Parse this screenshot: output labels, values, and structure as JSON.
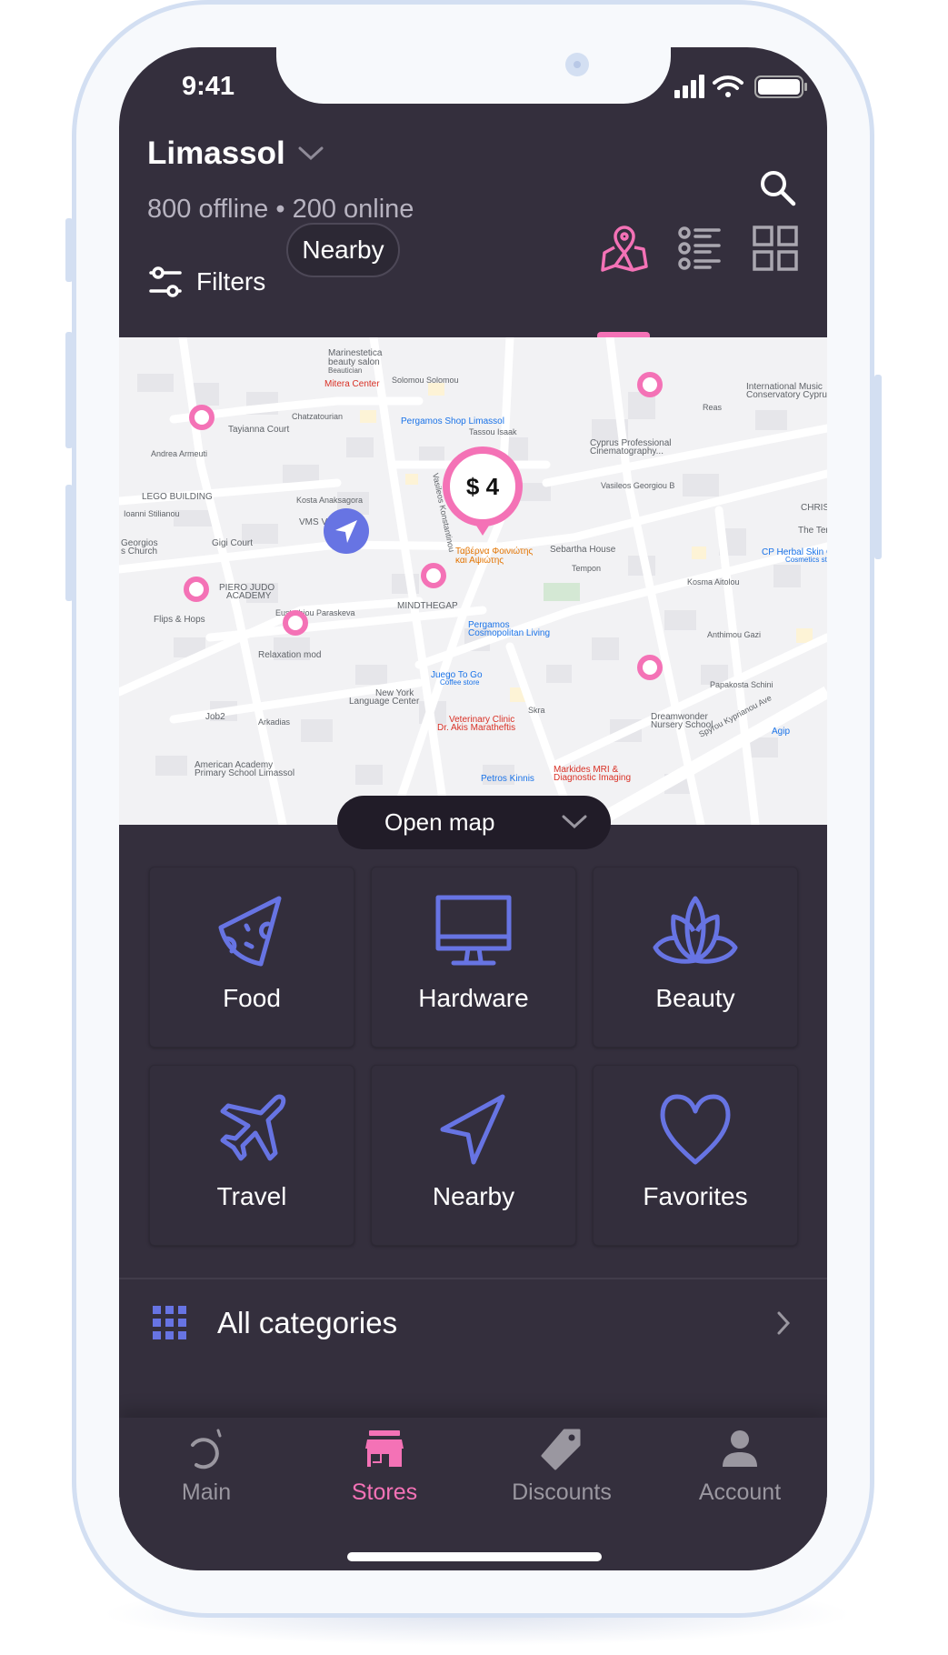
{
  "status_bar": {
    "time": "9:41",
    "icons": [
      "cellular-signal-icon",
      "wifi-icon",
      "battery-icon"
    ]
  },
  "header": {
    "city": "Limassol",
    "stats": "800 offline • 200 online",
    "filters_label": "Filters",
    "nearby_label": "Nearby",
    "active_view": "map",
    "views": [
      "map",
      "list",
      "grid"
    ]
  },
  "map": {
    "price_bubble": "$ 4",
    "labels": {
      "l1": "Marinestetica",
      "l2": "beauty salon",
      "l3": "Beautician",
      "l4": "Mitera Center",
      "l5": "Solomou Solomou",
      "l6": "Pergamos Shop Limassol",
      "l7": "Tassou Isaak",
      "l8": "Tayianna Court",
      "l9": "Chatzatourian",
      "l10": "Andrea Armeuti",
      "l11": "LEGO BUILDING",
      "l12": "Ioanni Stilianou",
      "l13": "Kosta Anaksagora",
      "l14": "VMS Vasiliou",
      "l15": "Gigi Court",
      "l16": "Georgios",
      "l17": "s Church",
      "l18": "Vasileos Konstantinou",
      "l19": "Ταβέρνα Φοινιώτης",
      "l20": "και Αψιώτης",
      "l21": "Sebartha House",
      "l22": "PIERO JUDO",
      "l23": "ACADEMY",
      "l24": "Eustathiou Paraskeva",
      "l25": "MINDTHEGAP",
      "l26": "Flips & Hops",
      "l27": "Pergamos",
      "l28": "Cosmopolitan Living",
      "l29": "Relaxation mod",
      "l30": "Juego To Go",
      "l31": "Coffee store",
      "l32": "New York",
      "l33": "Language Center",
      "l34": "Job2",
      "l35": "Arkadias",
      "l36": "Veterinary Clinic",
      "l37": "Dr. Akis Maratheftis",
      "l38": "American Academy",
      "l39": "Primary School Limassol",
      "l40": "Petros Kinnis",
      "l41": "Markides MRI &",
      "l42": "Diagnostic Imaging",
      "l43": "Cyprus Professional",
      "l44": "Cinematography...",
      "l45": "Vasileos Georgiou B",
      "l46": "International Music",
      "l47": "Conservatory Cyprus",
      "l48": "Reas",
      "l49": "CHRIST",
      "l50": "The Tenne",
      "l51": "CP Herbal Skin Car",
      "l52": "Cosmetics store",
      "l53": "Kosma Aitolou",
      "l54": "Anthimou Gazi",
      "l55": "Papakosta Schini",
      "l56": "Dreamwonder",
      "l57": "Nursery School",
      "l58": "Spyrou Kyprianou Ave",
      "l59": "Agip",
      "l60": "Tempon",
      "l61": "Skra"
    },
    "open_map_label": "Open map"
  },
  "categories": [
    {
      "label": "Food",
      "icon": "pizza-slice-icon"
    },
    {
      "label": "Hardware",
      "icon": "monitor-icon"
    },
    {
      "label": "Beauty",
      "icon": "lotus-icon"
    },
    {
      "label": "Travel",
      "icon": "airplane-icon"
    },
    {
      "label": "Nearby",
      "icon": "navigation-arrow-icon"
    },
    {
      "label": "Favorites",
      "icon": "heart-icon"
    }
  ],
  "all_categories_label": "All categories",
  "tabs": [
    {
      "label": "Main",
      "icon": "main-icon",
      "active": false
    },
    {
      "label": "Stores",
      "icon": "store-icon",
      "active": true
    },
    {
      "label": "Discounts",
      "icon": "tag-icon",
      "active": false
    },
    {
      "label": "Account",
      "icon": "user-icon",
      "active": false
    }
  ],
  "colors": {
    "background": "#342f3d",
    "accent_pink": "#f472b6",
    "accent_blue": "#6774e3",
    "inactive": "#9a97a0"
  }
}
